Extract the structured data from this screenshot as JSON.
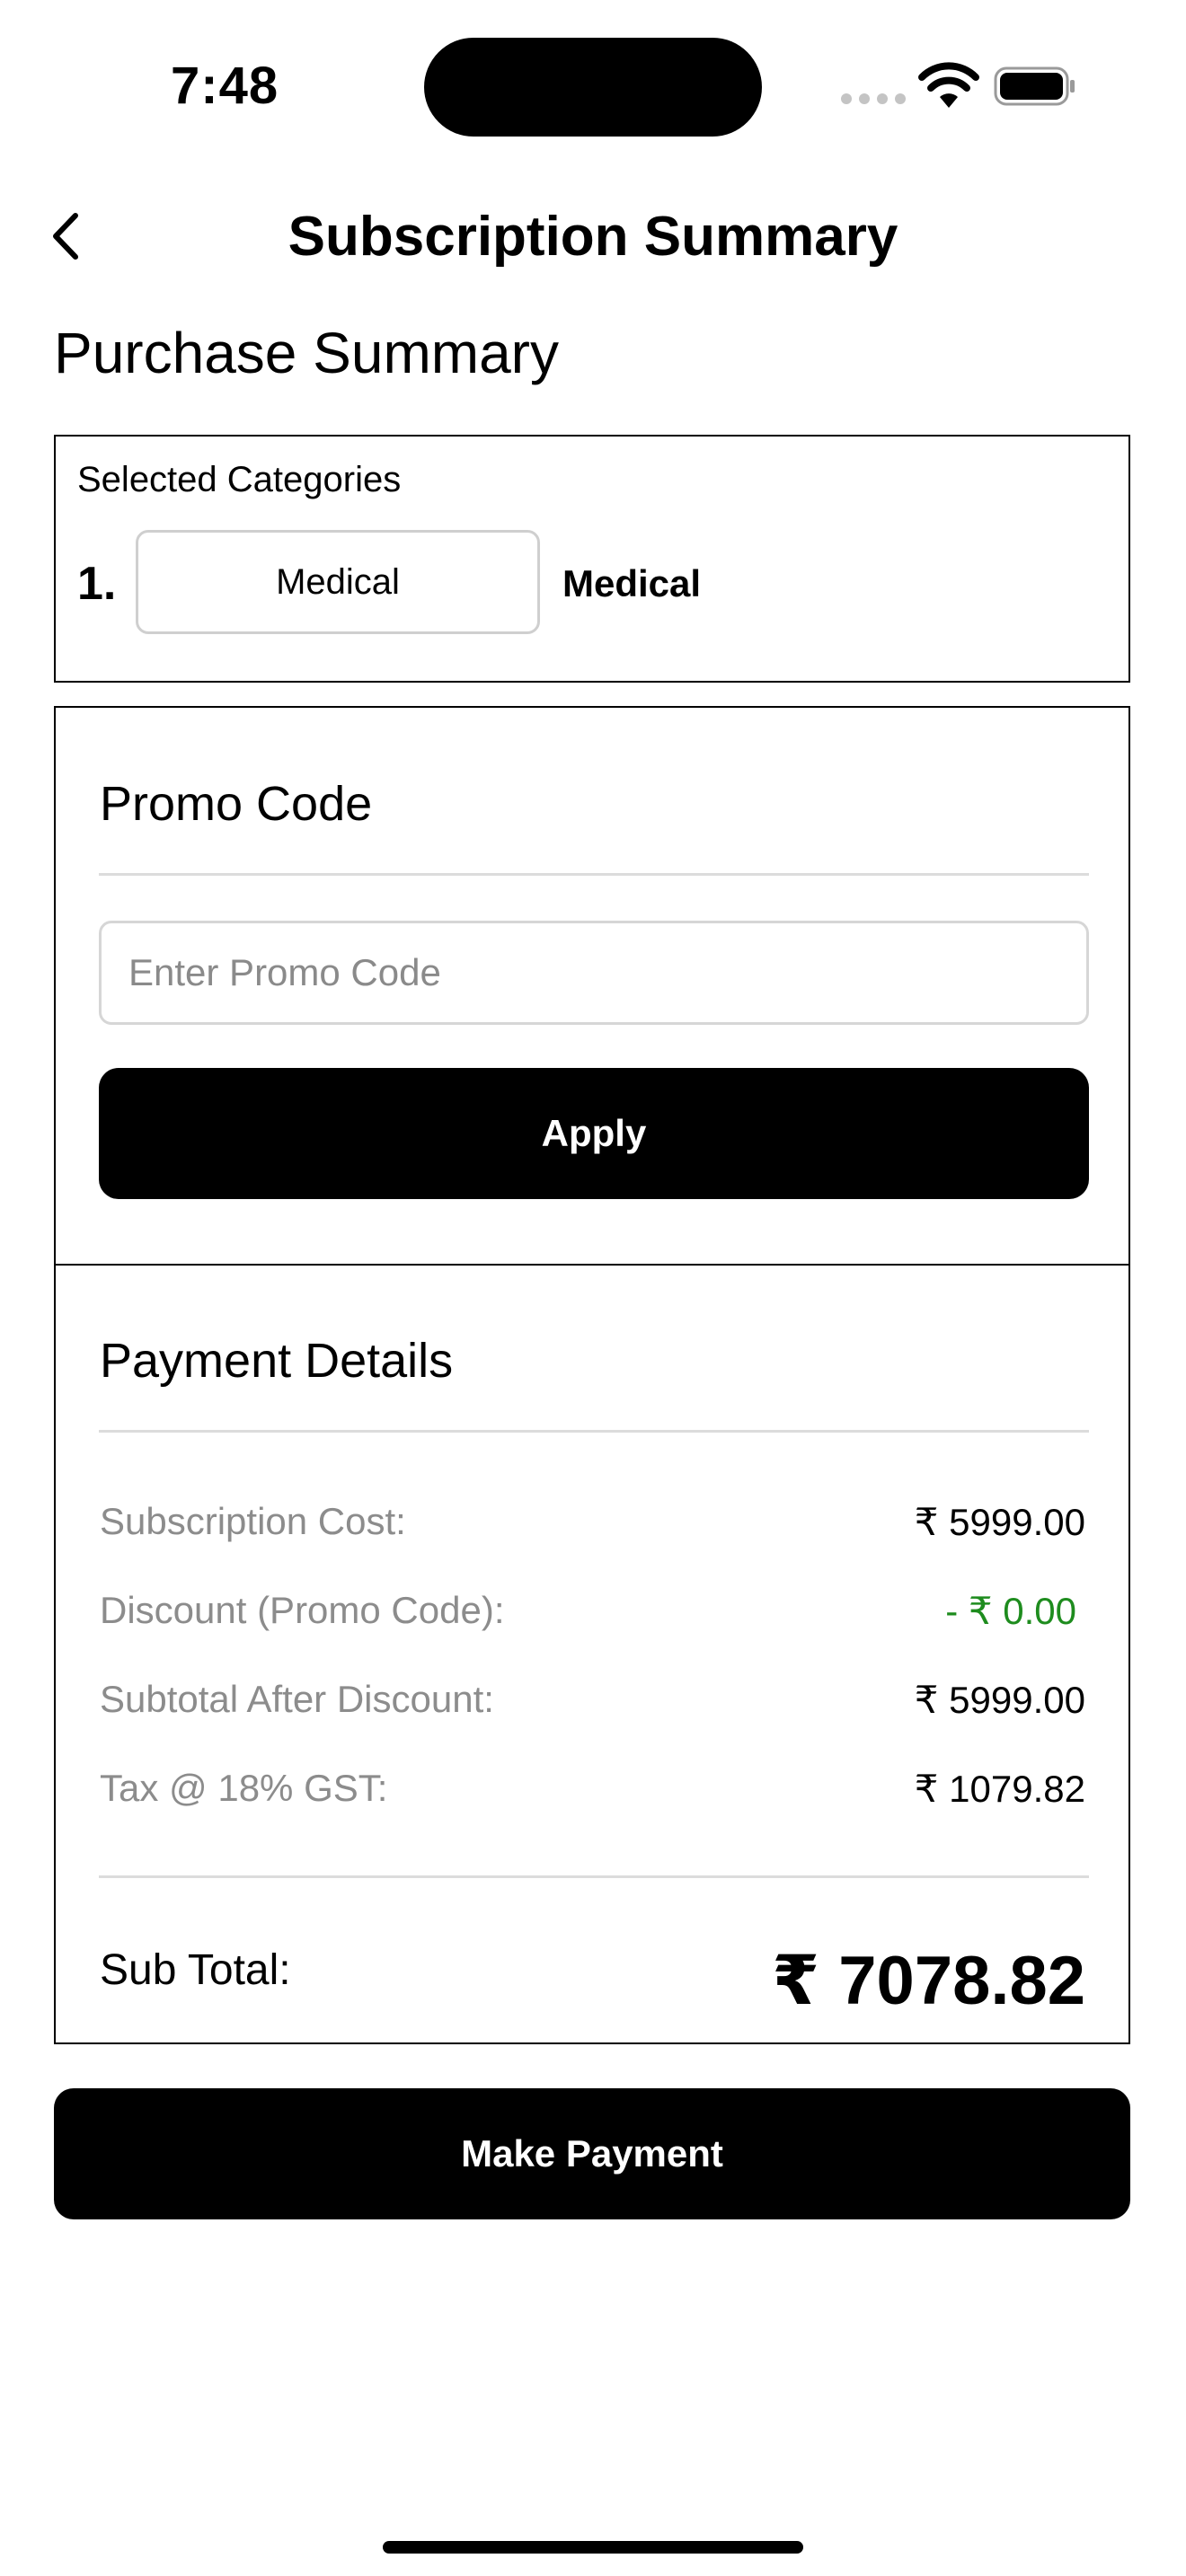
{
  "status_bar": {
    "time": "7:48",
    "icons": [
      "signal-dots-icon",
      "wifi-icon",
      "battery-icon"
    ]
  },
  "nav": {
    "back_icon": "chevron-left-icon",
    "title": "Subscription Summary"
  },
  "purchase": {
    "heading": "Purchase Summary",
    "categories_label": "Selected Categories",
    "items": [
      {
        "number": "1.",
        "chip": "Medical",
        "name": "Medical"
      }
    ]
  },
  "promo": {
    "title": "Promo Code",
    "placeholder": "Enter Promo Code",
    "value": "",
    "apply_label": "Apply"
  },
  "payment": {
    "title": "Payment Details",
    "rows": [
      {
        "label": "Subscription Cost:",
        "value": "₹ 5999.00"
      },
      {
        "label": "Discount (Promo Code):",
        "value": "- ₹ 0.00"
      },
      {
        "label": "Subtotal After Discount:",
        "value": "₹ 5999.00"
      },
      {
        "label": "Tax @ 18% GST:",
        "value": "₹ 1079.82"
      }
    ],
    "subtotal_label": "Sub Total:",
    "subtotal_value": "₹ 7078.82"
  },
  "actions": {
    "make_payment_label": "Make Payment"
  },
  "colors": {
    "discount_green": "#1e8c1e",
    "muted_label": "#8c8c8c",
    "primary_button": "#000000"
  }
}
